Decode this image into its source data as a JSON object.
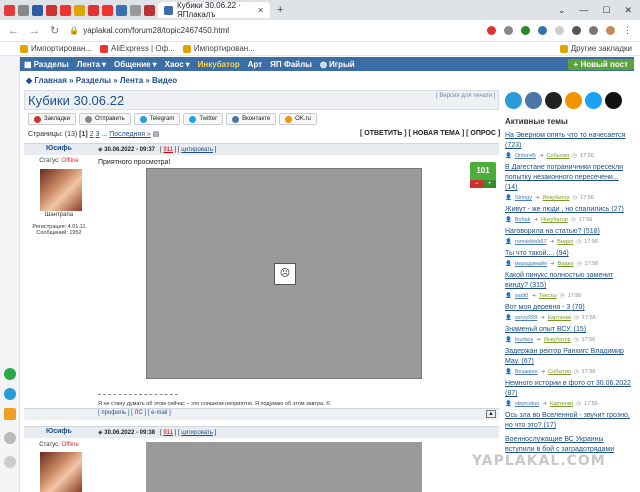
{
  "browser": {
    "tab_title": "Кубики 30.06.22 · ЯПлакалъ",
    "url": "yaplakal.com/forum28/topic2467450.html",
    "bookmarks": [
      "Импортирован...",
      "AliExpress | Оф...",
      "Импортирован..."
    ],
    "bookmarks_right": "Другие закладки"
  },
  "menu": {
    "items": [
      "Разделы",
      "Лента",
      "Общение",
      "Хаос",
      "Инкубатор",
      "Арт",
      "ЯП Файлы",
      "Игрый"
    ],
    "new_post": "Новый пост"
  },
  "breadcrumb": "Главная » Разделы » Лента » Видео",
  "topic": {
    "title": "Кубики 30.06.22",
    "print_link": "[ Версия для печати ]"
  },
  "share": [
    "Закладки",
    "Отправить",
    "Telegram",
    "Twitter",
    "Вконтакте",
    "OK.ru"
  ],
  "pager": {
    "label": "Страницы:",
    "count": "(13)",
    "current": "[1]",
    "pages": [
      "2",
      "3"
    ],
    "dots": "...",
    "last": "Последняя »"
  },
  "post_buttons": "[ ОТВЕТИТЬ ] [ НОВАЯ ТЕМА ] [ ОПРОС ]",
  "posts": [
    {
      "author": "Юсифь",
      "datetime": "30.06.2022 - 09:37",
      "num": "911",
      "quote": "цитировать",
      "status_label": "Статус:",
      "status": "Offline",
      "rank": "Шантрапа",
      "reg": "Регистрация: 4.01.11",
      "msgs": "Сообщений: 1952",
      "text": "Приятного просмотра!",
      "rating": "101",
      "signature": "Я не стану думать об этом сейчас – это слишком неприятно. Я подумаю об этом завтра. ©",
      "profile_links": "[ профиль ] [ ЛС ] [ e-mail ]"
    },
    {
      "author": "Юсифь",
      "datetime": "30.06.2022 - 09:38",
      "num": "911",
      "quote": "цитировать",
      "status_label": "Статус:",
      "status": "Offline"
    }
  ],
  "right_panel": {
    "heading": "Активные темы",
    "topics": [
      {
        "title": "На Эверном опять что то начесается",
        "count": "(723)",
        "user": "Oriton45",
        "cat": "События",
        "time": "17:56"
      },
      {
        "title": "В Дагестане пограничники пресекли попытку незаконного пересечени...",
        "count": "(14)",
        "user": "Stringy",
        "cat": "Инкубатор",
        "time": "17:56"
      },
      {
        "title": "Живут - же люди , но спалились",
        "count": "(27)",
        "user": "Bohak",
        "cat": "Инкубатор",
        "time": "17:56"
      },
      {
        "title": "Наговорила на статью?",
        "count": "(518)",
        "user": "ronnieblob67",
        "cat": "Видео",
        "time": "17:56"
      },
      {
        "title": "Ты что такой....",
        "count": "(94)",
        "user": "марадамайн",
        "cat": "Видео",
        "time": "17:56"
      },
      {
        "title": "Какой пинукс полностью заменит винду?",
        "count": "(315)",
        "user": "sadt0",
        "cat": "Тексты",
        "time": "17:56"
      },
      {
        "title": "Вот моя деревня - 3",
        "count": "(70)",
        "user": "ssroy999",
        "cat": "Картинки",
        "time": "17:56"
      },
      {
        "title": "Знаменьй опыт ВСУ.",
        "count": "(15)",
        "user": "tourbos",
        "cat": "Инкубатор",
        "time": "17:56"
      },
      {
        "title": "Задержан ректор Ранхигс Владимир Мау.",
        "count": "(67)",
        "user": "Вешкинн",
        "cat": "События",
        "time": "17:56"
      },
      {
        "title": "Немного истории в фото от 30.06.2022",
        "count": "(87)",
        "user": "oleproduo",
        "cat": "Картинки",
        "time": "17:56"
      },
      {
        "title": "Ось зла во Вселенной - звучит грозно, но что это?",
        "count": "(17)",
        "user": "",
        "cat": "",
        "time": ""
      },
      {
        "title": "Военнослужащие ВС Украины вступили в бой с заградотрядами",
        "count": "",
        "user": "",
        "cat": "",
        "time": ""
      }
    ]
  },
  "watermark": "YAPLAKAL.COM"
}
